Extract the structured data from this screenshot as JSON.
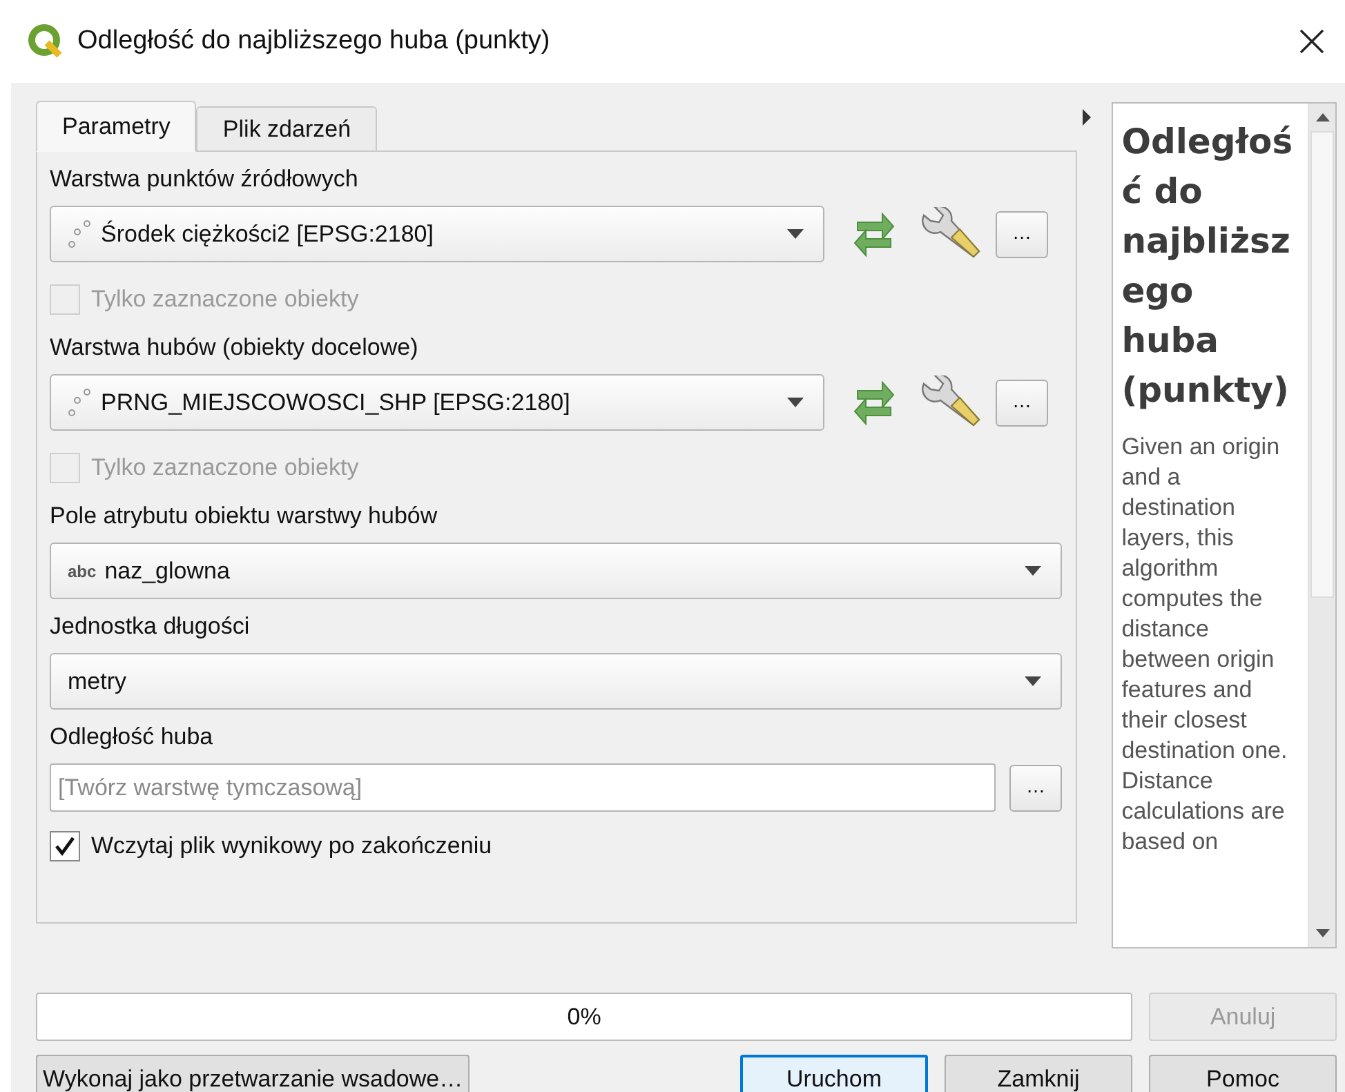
{
  "window": {
    "title": "Odległość do najbliższego huba (punkty)"
  },
  "tabs": [
    {
      "label": "Parametry",
      "selected": true
    },
    {
      "label": "Plik zdarzeń",
      "selected": false
    }
  ],
  "parameters": [
    {
      "kind": "layer",
      "label": "Warstwa punktów źródłowych",
      "value": "Środek ciężkości2 [EPSG:2180]",
      "more": "…",
      "selected_only": {
        "label": "Tylko zaznaczone obiekty",
        "checked": false,
        "disabled": true
      }
    },
    {
      "kind": "layer",
      "label": "Warstwa hubów (obiekty docelowe)",
      "value": "PRNG_MIEJSCOWOSCI_SHP [EPSG:2180]",
      "more": "…",
      "selected_only": {
        "label": "Tylko zaznaczone obiekty",
        "checked": false,
        "disabled": true
      }
    },
    {
      "kind": "field",
      "label": "Pole atrybutu obiektu warstwy hubów",
      "badge": "abc",
      "value": "naz_glowna"
    },
    {
      "kind": "enum",
      "label": "Jednostka długości",
      "value": "metry"
    },
    {
      "kind": "output",
      "label": "Odległość huba",
      "placeholder": "[Twórz warstwę tymczasową]",
      "more": "…",
      "open_after": {
        "label": "Wczytaj plik wynikowy po zakończeniu",
        "checked": true,
        "disabled": false
      }
    }
  ],
  "help": {
    "title": "Odległość do najbliższego huba (punkty)",
    "text": "Given an origin and a destination layers, this algorithm computes the distance between origin features and their closest destination one. Distance calculations are based on"
  },
  "progress": {
    "level": 0,
    "reading": "0%"
  },
  "cancel_button": {
    "label": "Anuluj",
    "disabled": true
  },
  "batch_button": {
    "label": "Wykonaj jako przetwarzanie wsadowe…"
  },
  "buttons": [
    {
      "label": "Uruchom",
      "default": true
    },
    {
      "label": "Zamknij",
      "default": false
    },
    {
      "label": "Pomoc",
      "default": false
    }
  ]
}
